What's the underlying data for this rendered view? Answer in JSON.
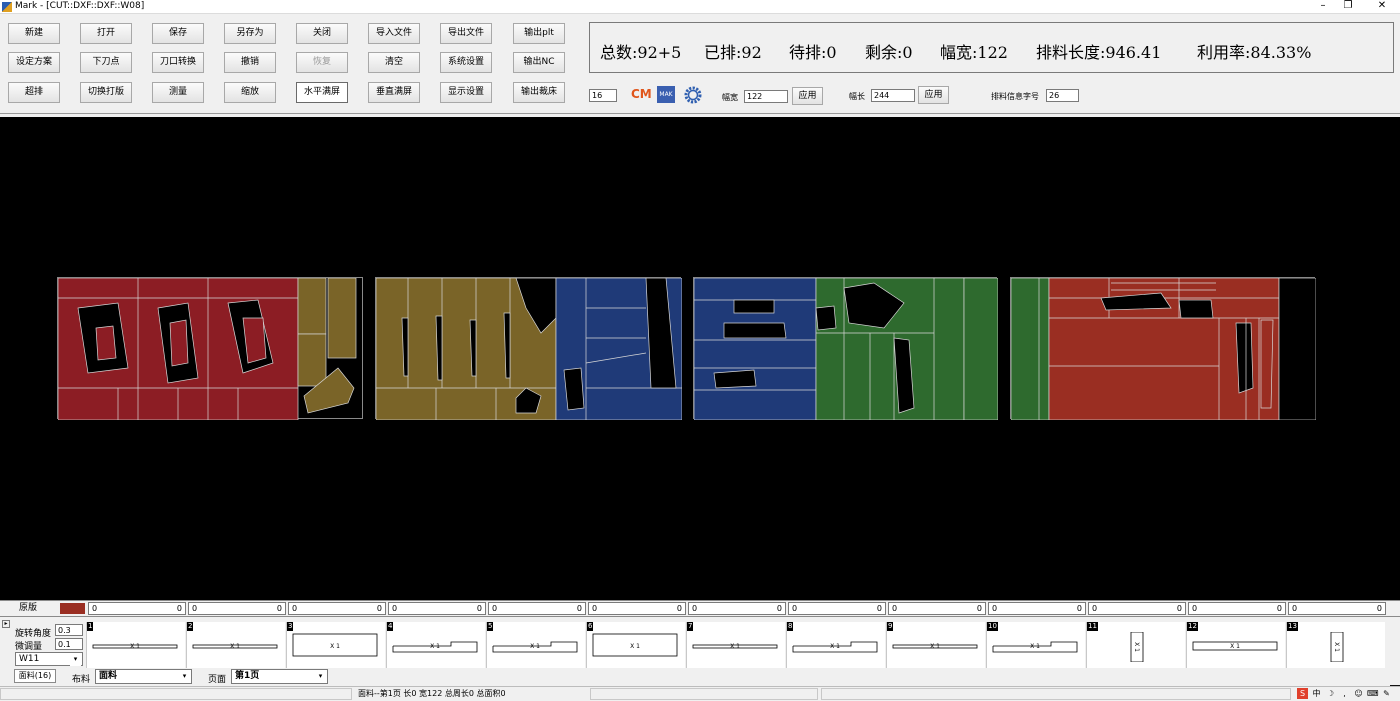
{
  "window": {
    "title": "Mark - [CUT::DXF::DXF::W08]"
  },
  "toolbar": {
    "row1": [
      "新建",
      "打开",
      "保存",
      "另存为",
      "关闭",
      "导入文件",
      "导出文件",
      "输出plt"
    ],
    "row2": [
      "设定方案",
      "下刀点",
      "刀口转换",
      "撤销",
      "恢复",
      "清空",
      "系统设置",
      "输出NC"
    ],
    "row3": [
      "超排",
      "切换打版",
      "测量",
      "缩放",
      "水平满屏",
      "垂直满屏",
      "显示设置",
      "输出裁床"
    ]
  },
  "stats": {
    "total": "总数:92+5",
    "placed": "已排:92",
    "pending": "待排:0",
    "remaining": "剩余:0",
    "width": "幅宽:122",
    "length": "排料长度:946.41",
    "utilization": "利用率:84.33%"
  },
  "settings": {
    "gap_value": "16",
    "cm_icon": "cm-icon",
    "width_label": "幅宽",
    "width_value": "122",
    "apply1": "应用",
    "length_label": "幅长",
    "length_value": "244",
    "apply2": "应用",
    "info_font_label": "排料信息字号",
    "info_font_value": "26"
  },
  "original_row": {
    "label": "原版",
    "swatch_color": "#9a2e22",
    "cells": [
      [
        "0",
        "0"
      ],
      [
        "0",
        "0"
      ],
      [
        "0",
        "0"
      ],
      [
        "0",
        "0"
      ],
      [
        "0",
        "0"
      ],
      [
        "0",
        "0"
      ],
      [
        "0",
        "0"
      ],
      [
        "0",
        "0"
      ],
      [
        "0",
        "0"
      ],
      [
        "0",
        "0"
      ],
      [
        "0",
        "0"
      ],
      [
        "0",
        "0"
      ],
      [
        "0",
        "0"
      ]
    ]
  },
  "parts_panel": {
    "rotation_label": "旋转角度",
    "rotation_value": "0.3",
    "fine_label": "微调量",
    "fine_value": "0.1",
    "material_code": "W11",
    "parts": [
      {
        "num": "1",
        "qty": "X 1",
        "shape": "bar"
      },
      {
        "num": "2",
        "qty": "X 1",
        "shape": "bar"
      },
      {
        "num": "3",
        "qty": "X 1",
        "shape": "box"
      },
      {
        "num": "4",
        "qty": "X 1",
        "shape": "step"
      },
      {
        "num": "5",
        "qty": "X 1",
        "shape": "step"
      },
      {
        "num": "6",
        "qty": "X 1",
        "shape": "box"
      },
      {
        "num": "7",
        "qty": "X 1",
        "shape": "bar"
      },
      {
        "num": "8",
        "qty": "X 1",
        "shape": "step"
      },
      {
        "num": "9",
        "qty": "X 1",
        "shape": "bar"
      },
      {
        "num": "10",
        "qty": "X 1",
        "shape": "step"
      },
      {
        "num": "11",
        "qty": "X 1",
        "shape": "vert"
      },
      {
        "num": "12",
        "qty": "X 1",
        "shape": "wide"
      },
      {
        "num": "13",
        "qty": "X 1",
        "shape": "vert"
      }
    ]
  },
  "bottom": {
    "tab_label": "面料(16)",
    "fabric_label": "布料",
    "fabric_value": "面料",
    "page_label": "页面",
    "page_value": "第1页"
  },
  "status": {
    "text": "面料--第1页  长0  宽122  总周长0  总面积0"
  },
  "sheets": [
    {
      "color": "#8c1d24"
    },
    {
      "color": "#7a6428"
    },
    {
      "color": "#1f3a78"
    },
    {
      "color": "#2e6a2e"
    },
    {
      "color": "#9a2e22"
    }
  ]
}
